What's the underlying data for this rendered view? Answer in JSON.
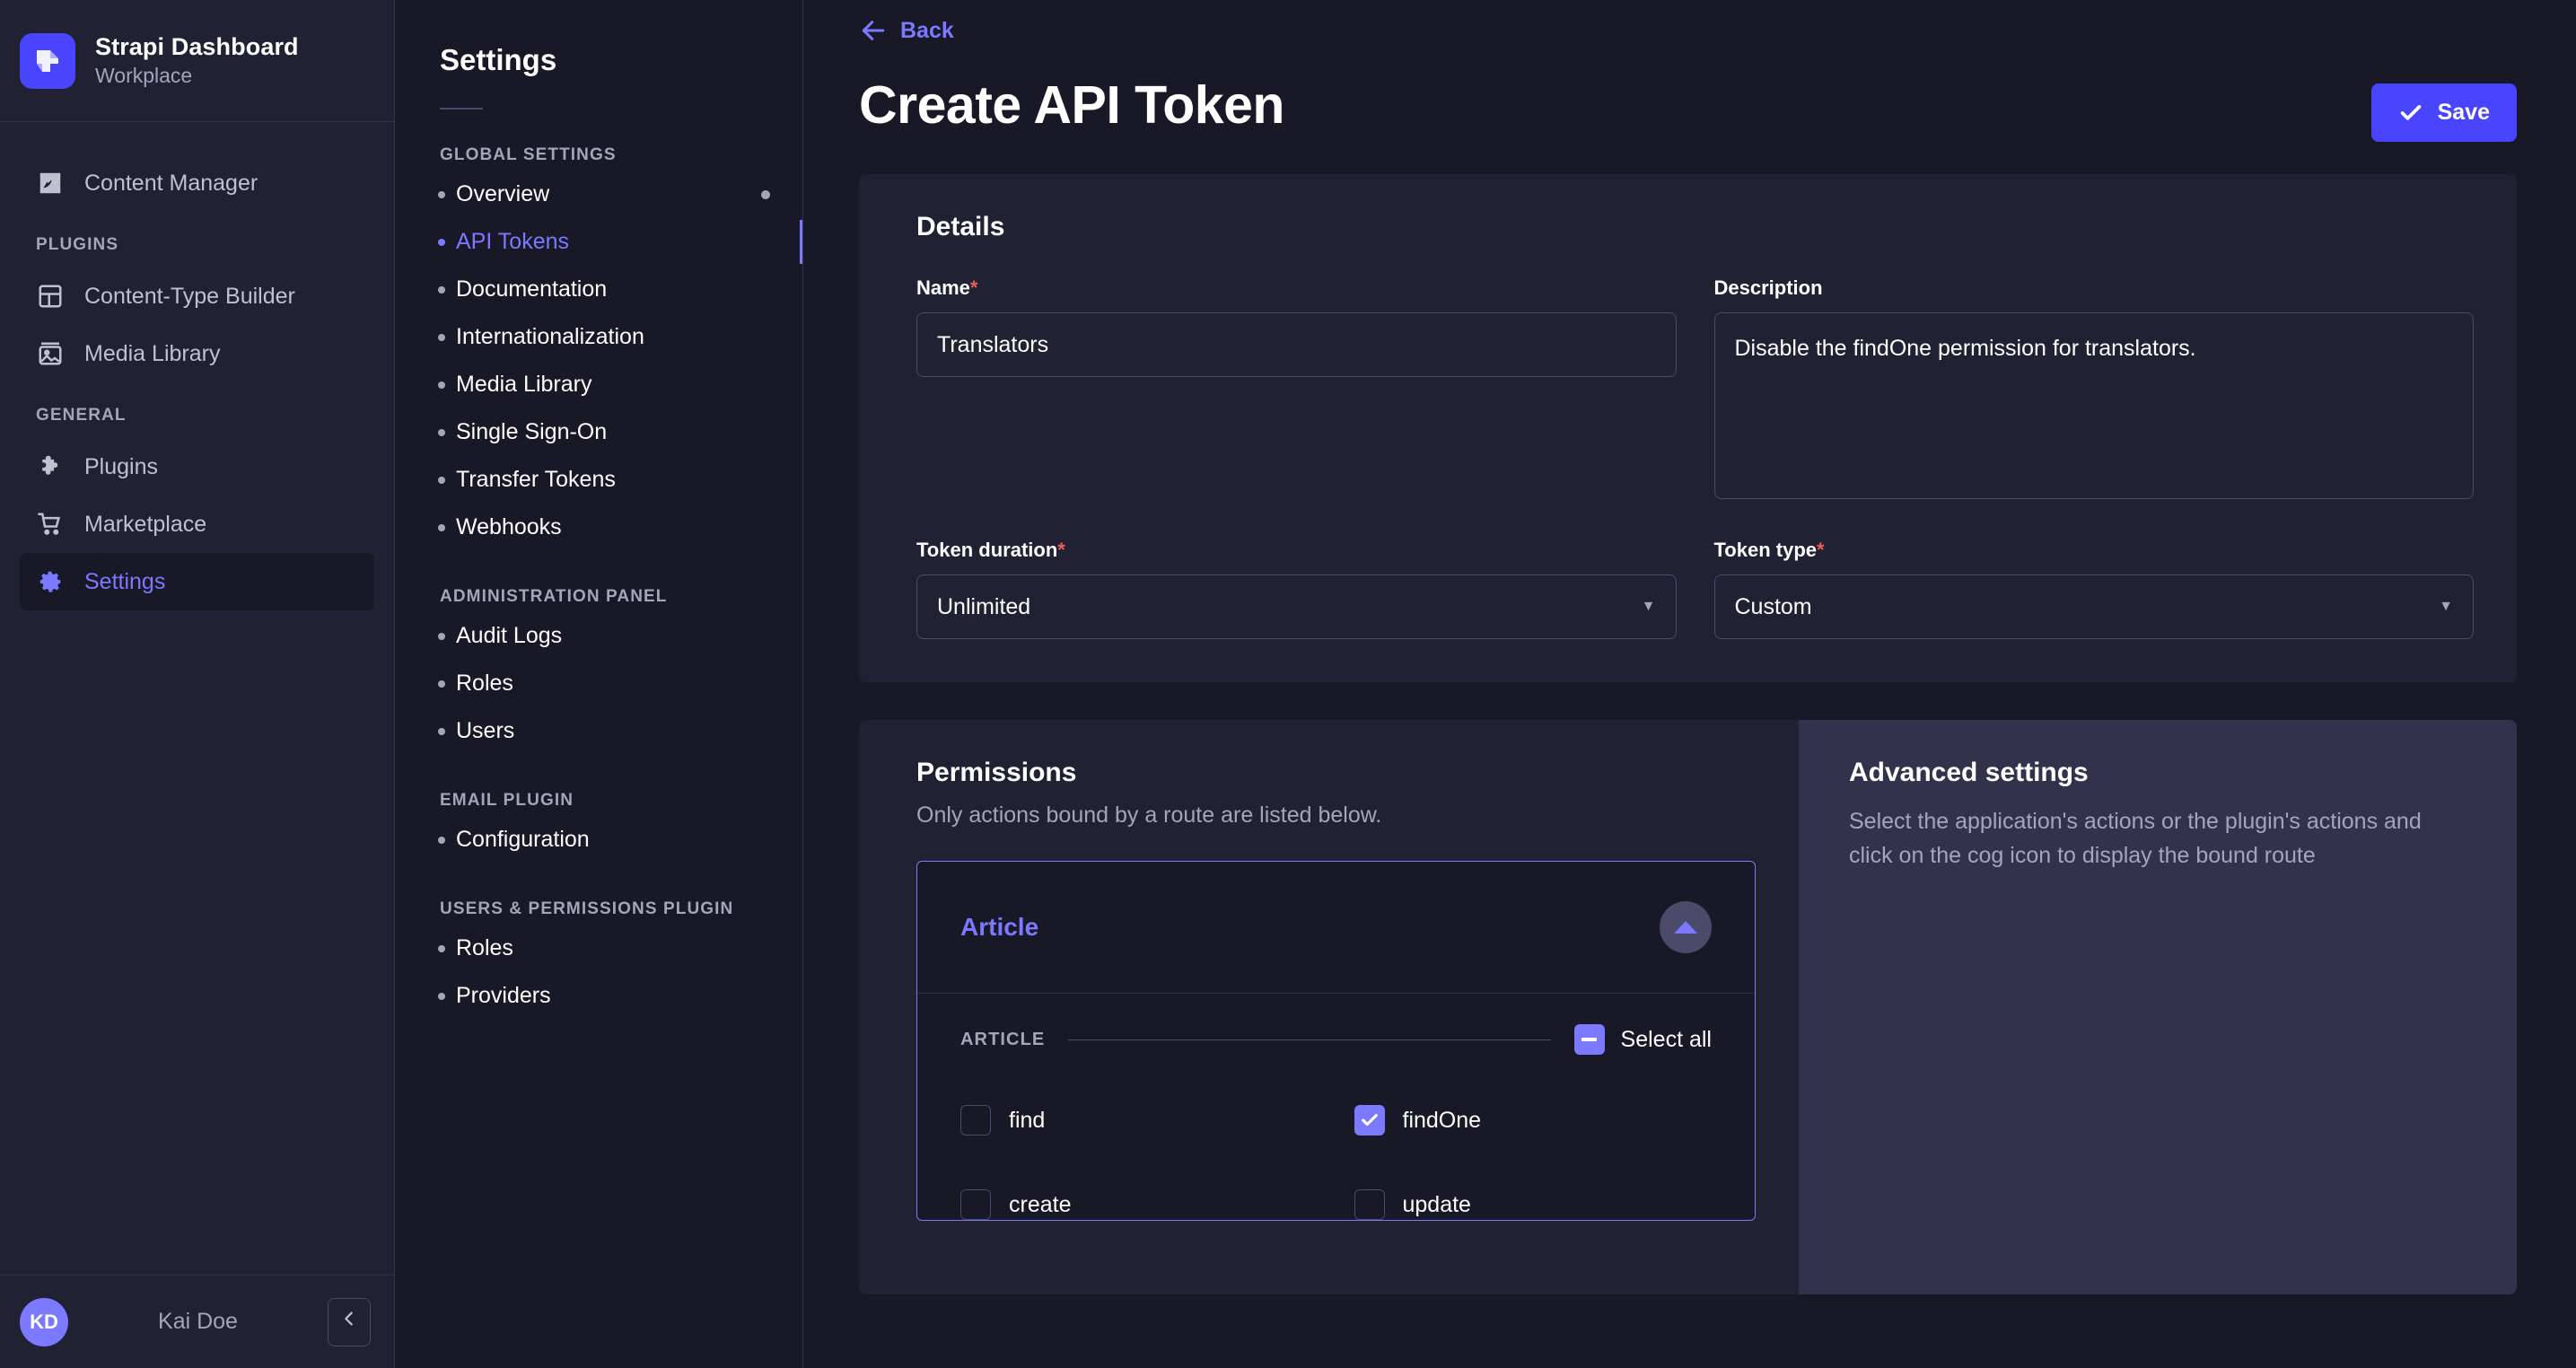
{
  "sidebar": {
    "brand": {
      "title": "Strapi Dashboard",
      "subtitle": "Workplace",
      "logo_icon": "strapi-logo-icon"
    },
    "primary_item": {
      "label": "Content Manager",
      "icon": "feather-pen-icon"
    },
    "groups": [
      {
        "label": "PLUGINS",
        "items": [
          {
            "label": "Content-Type Builder",
            "icon": "layout-grid-icon"
          },
          {
            "label": "Media Library",
            "icon": "image-icon"
          }
        ]
      },
      {
        "label": "GENERAL",
        "items": [
          {
            "label": "Plugins",
            "icon": "puzzle-piece-icon"
          },
          {
            "label": "Marketplace",
            "icon": "shopping-cart-icon"
          },
          {
            "label": "Settings",
            "icon": "gear-icon",
            "active": true
          }
        ]
      }
    ],
    "footer": {
      "avatar_initials": "KD",
      "user_name": "Kai Doe",
      "collapse_icon": "chevron-left-icon"
    }
  },
  "subnav": {
    "title": "Settings",
    "groups": [
      {
        "label": "GLOBAL SETTINGS",
        "items": [
          {
            "label": "Overview",
            "trailing_dot": true
          },
          {
            "label": "API Tokens",
            "active": true
          },
          {
            "label": "Documentation"
          },
          {
            "label": "Internationalization"
          },
          {
            "label": "Media Library"
          },
          {
            "label": "Single Sign-On"
          },
          {
            "label": "Transfer Tokens"
          },
          {
            "label": "Webhooks"
          }
        ]
      },
      {
        "label": "ADMINISTRATION PANEL",
        "items": [
          {
            "label": "Audit Logs"
          },
          {
            "label": "Roles"
          },
          {
            "label": "Users"
          }
        ]
      },
      {
        "label": "EMAIL PLUGIN",
        "items": [
          {
            "label": "Configuration"
          }
        ]
      },
      {
        "label": "USERS & PERMISSIONS PLUGIN",
        "items": [
          {
            "label": "Roles"
          },
          {
            "label": "Providers"
          }
        ]
      }
    ]
  },
  "main": {
    "back_label": "Back",
    "back_icon": "arrow-left-icon",
    "page_title": "Create API Token",
    "save_label": "Save",
    "save_icon": "check-icon",
    "details": {
      "heading": "Details",
      "name_label": "Name",
      "name_required": "*",
      "name_value": "Translators",
      "description_label": "Description",
      "description_value": "Disable the findOne permission for translators.",
      "token_duration_label": "Token duration",
      "token_duration_required": "*",
      "token_duration_value": "Unlimited",
      "token_type_label": "Token type",
      "token_type_required": "*",
      "token_type_value": "Custom",
      "caret_icon": "chevron-down-icon"
    },
    "permissions": {
      "heading": "Permissions",
      "subtitle": "Only actions bound by a route are listed below.",
      "collection_name": "Article",
      "collapse_icon": "chevron-up-icon",
      "sub_heading": "ARTICLE",
      "select_all_label": "Select all",
      "select_all_state": "indeterminate",
      "actions": [
        {
          "label": "find",
          "checked": false
        },
        {
          "label": "findOne",
          "checked": true
        },
        {
          "label": "create",
          "checked": false
        },
        {
          "label": "update",
          "checked": false
        }
      ]
    },
    "advanced": {
      "heading": "Advanced settings",
      "body": "Select the application's actions or the plugin's actions and click on the cog icon to display the bound route"
    }
  },
  "colors": {
    "accent": "#4945ff",
    "accent_light": "#7b79ff",
    "bg": "#181826",
    "panel": "#212134",
    "panel_alt": "#32324d",
    "border": "#4a4a6a",
    "text": "#ffffff",
    "text_muted": "#a5a5ba",
    "required": "#ee5e52"
  }
}
